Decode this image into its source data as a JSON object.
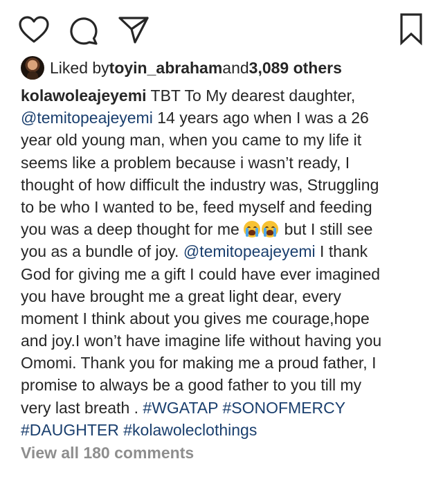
{
  "actions": {
    "like_icon": "heart-outline-icon",
    "comment_icon": "comment-bubble-icon",
    "share_icon": "paper-plane-icon",
    "save_icon": "bookmark-outline-icon"
  },
  "likes": {
    "prefix": "Liked by ",
    "username": "toyin_abraham",
    "middle": " and ",
    "others": "3,089 others"
  },
  "caption": {
    "author": "kolawoleajeyemi",
    "lines": [
      [
        {
          "t": "u",
          "v": "kolawoleajeyemi"
        },
        {
          "t": "x",
          "v": " TBT To My dearest daughter,"
        }
      ],
      [
        {
          "t": "m",
          "v": "@temitopeajeyemi"
        },
        {
          "t": "x",
          "v": " 14 years ago when I was a 26"
        }
      ],
      [
        {
          "t": "x",
          "v": "year old young man, when you came to my life it"
        }
      ],
      [
        {
          "t": "x",
          "v": "seems like a problem because i wasn’t ready, I"
        }
      ],
      [
        {
          "t": "x",
          "v": "thought of how difficult the industry was, Struggling"
        }
      ],
      [
        {
          "t": "x",
          "v": "to be who I wanted to be, feed myself and feeding"
        }
      ],
      [
        {
          "t": "x",
          "v": "you was a deep thought for me "
        },
        {
          "t": "e",
          "v": "😭"
        },
        {
          "t": "e",
          "v": "😭"
        },
        {
          "t": "x",
          "v": " but I still see"
        }
      ],
      [
        {
          "t": "x",
          "v": "you as a bundle of joy. "
        },
        {
          "t": "m",
          "v": "@temitopeajeyemi"
        },
        {
          "t": "x",
          "v": " I thank"
        }
      ],
      [
        {
          "t": "x",
          "v": "God for giving me a gift I could have ever imagined"
        }
      ],
      [
        {
          "t": "x",
          "v": "you have brought me a great light dear, every"
        }
      ],
      [
        {
          "t": "x",
          "v": "moment I think about you gives me courage,hope"
        }
      ],
      [
        {
          "t": "x",
          "v": "and joy.I won’t have imagine life without having you"
        }
      ],
      [
        {
          "t": "x",
          "v": "Omomi. Thank you for making me a proud father, I"
        }
      ],
      [
        {
          "t": "x",
          "v": "promise to always be a good father to you till my"
        }
      ],
      [
        {
          "t": "x",
          "v": "very last breath . "
        },
        {
          "t": "h",
          "v": "#WGATAP"
        },
        {
          "t": "x",
          "v": " "
        },
        {
          "t": "h",
          "v": "#SONOFMERCY"
        }
      ],
      [
        {
          "t": "h",
          "v": "#DAUGHTER"
        },
        {
          "t": "x",
          "v": " "
        },
        {
          "t": "h",
          "v": "#kolawoleclothings"
        }
      ]
    ]
  },
  "comments": {
    "view_all_label": "View all 180 comments"
  },
  "colors": {
    "text": "#262626",
    "link": "#1a3f6e",
    "muted": "#8e8e8e"
  }
}
